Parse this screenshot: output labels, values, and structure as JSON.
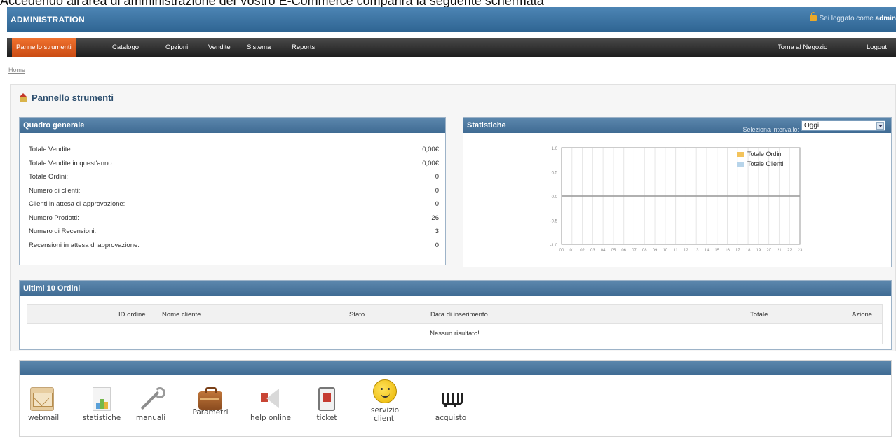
{
  "caption": "Accedendo all'area di amministrazione del Vostro E-Commerce comparirà la seguente schermata",
  "header": {
    "brand": "ADMINISTRATION",
    "login_text": "Sei loggato come",
    "login_user": "admin"
  },
  "menu": {
    "items": [
      "Pannello strumenti",
      "Catalogo",
      "Opzioni",
      "Vendite",
      "Sistema",
      "Reports"
    ],
    "right_items": [
      "Torna al Negozio",
      "Logout"
    ]
  },
  "breadcrumb": "Home",
  "page_title": "Pannello strumenti",
  "overview": {
    "title": "Quadro generale",
    "rows": [
      {
        "label": "Totale Vendite:",
        "value": "0,00€"
      },
      {
        "label": "Totale Vendite in quest'anno:",
        "value": "0,00€"
      },
      {
        "label": "Totale Ordini:",
        "value": "0"
      },
      {
        "label": "Numero di clienti:",
        "value": "0"
      },
      {
        "label": "Clienti in attesa di approvazione:",
        "value": "0"
      },
      {
        "label": "Numero Prodotti:",
        "value": "26"
      },
      {
        "label": "Numero di Recensioni:",
        "value": "3"
      },
      {
        "label": "Recensioni in attesa di approvazione:",
        "value": "0"
      }
    ]
  },
  "stats": {
    "title": "Statistiche",
    "interval_label": "Seleziona intervallo:",
    "interval_value": "Oggi"
  },
  "chart_data": {
    "type": "line",
    "title": "",
    "x": [
      "00",
      "01",
      "02",
      "03",
      "04",
      "05",
      "06",
      "07",
      "08",
      "09",
      "10",
      "11",
      "12",
      "13",
      "14",
      "15",
      "16",
      "17",
      "18",
      "19",
      "20",
      "21",
      "22",
      "23"
    ],
    "series": [
      {
        "name": "Totale Ordini",
        "values": [
          0,
          0,
          0,
          0,
          0,
          0,
          0,
          0,
          0,
          0,
          0,
          0,
          0,
          0,
          0,
          0,
          0,
          0,
          0,
          0,
          0,
          0,
          0,
          0
        ],
        "color": "#f3c35b"
      },
      {
        "name": "Totale Clienti",
        "values": [
          0,
          0,
          0,
          0,
          0,
          0,
          0,
          0,
          0,
          0,
          0,
          0,
          0,
          0,
          0,
          0,
          0,
          0,
          0,
          0,
          0,
          0,
          0,
          0
        ],
        "color": "#b7d4ea"
      }
    ],
    "yticks": [
      "1.0",
      "0.5",
      "0.0",
      "-0.5",
      "-1.0"
    ],
    "ylim": [
      -1,
      1
    ],
    "grid": true,
    "legend": "top-right"
  },
  "orders": {
    "title": "Ultimi 10 Ordini",
    "columns": {
      "id": "ID ordine",
      "customer": "Nome cliente",
      "status": "Stato",
      "date": "Data di inserimento",
      "total": "Totale",
      "action": "Azione"
    },
    "empty_text": "Nessun risultato!"
  },
  "tools": {
    "items": [
      {
        "label": "webmail",
        "icon": "mail-icon"
      },
      {
        "label": "statistiche",
        "icon": "statistics-icon"
      },
      {
        "label": "manuali",
        "icon": "wrench-icon"
      },
      {
        "label": "Parametri",
        "icon": "briefcase-icon"
      },
      {
        "label": "help online",
        "icon": "megaphone-icon"
      },
      {
        "label": "ticket",
        "icon": "ticket-icon"
      },
      {
        "label": "servizio clienti",
        "icon": "headset-icon"
      },
      {
        "label": "acquisto",
        "icon": "cart-icon"
      }
    ]
  }
}
